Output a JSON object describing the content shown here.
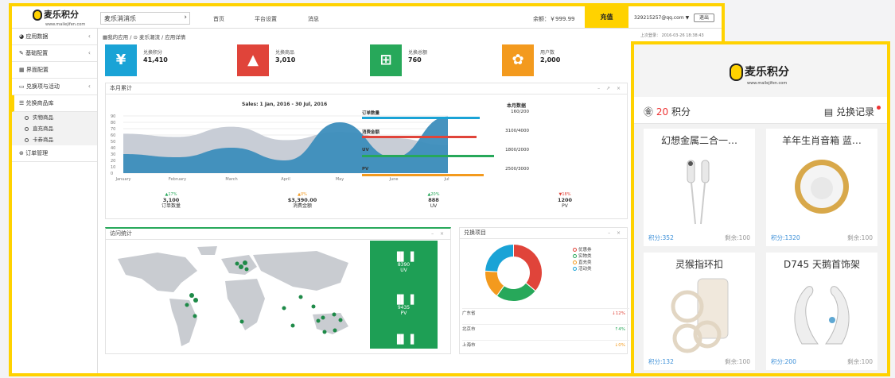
{
  "admin": {
    "logo": {
      "name": "麦乐积分",
      "url": "www.mailejifen.com"
    },
    "app_select": "麦乐消消乐",
    "top_nav": [
      "首页",
      "平台设置",
      "消息"
    ],
    "balance": "余额：￥999.99",
    "recharge": "充值",
    "user": "329215257@qq.com ▼",
    "logout": "退出",
    "last_login": "上次登录： 2016-03-26 18:38:43",
    "sidebar": [
      {
        "label": "应用数据",
        "chev": "‹"
      },
      {
        "label": "基础配置",
        "chev": "‹"
      },
      {
        "label": "界面配置",
        "chev": ""
      },
      {
        "label": "兑换项与活动",
        "chev": "‹"
      },
      {
        "label": "兑换商品库",
        "chev": ""
      }
    ],
    "sidebar_sub": [
      "实物商品",
      "直充商品",
      "卡券商品"
    ],
    "sidebar_last": "订单管理",
    "breadcrumb": "▦我的应用 / ⊙ 麦乐潮流 / 应用详情",
    "cards": [
      {
        "icon": "¥",
        "label": "兑换积分",
        "value": "41,410",
        "color": "#1aa3d6"
      },
      {
        "icon": "▲",
        "label": "兑换商品",
        "value": "3,010",
        "color": "#e0443a"
      },
      {
        "icon": "⊞",
        "label": "兑换总额",
        "value": "760",
        "color": "#27a85a"
      },
      {
        "icon": "✿",
        "label": "用户数",
        "value": "2,000",
        "color": "#f39a1e"
      }
    ],
    "monthly_panel_title": "本月累计",
    "chart_title": "Sales: 1 Jan, 2016 - 30 Jul, 2016",
    "month_data_title": "本月数据",
    "metrics": [
      {
        "name": "订单数量",
        "value": "160/200",
        "fraction": 0.8,
        "color": "#1aa3d6"
      },
      {
        "name": "消费金额",
        "value": "3100/4000",
        "fraction": 0.78,
        "color": "#e0443a"
      },
      {
        "name": "UV",
        "value": "1800/2000",
        "fraction": 0.9,
        "color": "#27a85a"
      },
      {
        "name": "PV",
        "value": "2500/3000",
        "fraction": 0.83,
        "color": "#f39a1e"
      }
    ],
    "stats": [
      {
        "change": "▲17%",
        "num": "3,100",
        "label": "订单数量",
        "color": "#27a85a"
      },
      {
        "change": "▲0%",
        "num": "$3,390.00",
        "label": "消费金额",
        "color": "#f39a1e"
      },
      {
        "change": "▲20%",
        "num": "888",
        "label": "UV",
        "color": "#27a85a"
      },
      {
        "change": "▼18%",
        "num": "1200",
        "label": "PV",
        "color": "#e0443a"
      }
    ],
    "visit_panel_title": "访问统计",
    "visit_blocks": [
      {
        "value": "8390",
        "label": "UV"
      },
      {
        "value": "9435",
        "label": "PV"
      }
    ],
    "exchange_panel_title": "兑换项目",
    "legend": [
      {
        "label": "优惠券",
        "color": "#e0443a"
      },
      {
        "label": "实物类",
        "color": "#27a85a"
      },
      {
        "label": "直充类",
        "color": "#f39a1e"
      },
      {
        "label": "活动类",
        "color": "#1aa3d6"
      }
    ],
    "provinces": [
      {
        "name": "广东省",
        "change": "↓12%",
        "color": "#e0443a"
      },
      {
        "name": "北京市",
        "change": "↑4%",
        "color": "#27a85a"
      },
      {
        "name": "上海市",
        "change": "↓0%",
        "color": "#f39a1e"
      }
    ]
  },
  "chart_data": [
    {
      "type": "area",
      "title": "Sales: 1 Jan, 2016 - 30 Jul, 2016",
      "categories": [
        "January",
        "February",
        "March",
        "April",
        "May",
        "June",
        "July"
      ],
      "series": [
        {
          "values": [
            62,
            57,
            73,
            52,
            65,
            55,
            44
          ],
          "color": "#c8cdd6"
        },
        {
          "values": [
            30,
            25,
            40,
            20,
            80,
            25,
            89
          ],
          "color": "#3c8dbc"
        }
      ],
      "ylim": [
        0,
        90
      ],
      "yticks": [
        0,
        10,
        20,
        30,
        40,
        50,
        60,
        70,
        80,
        90
      ]
    },
    {
      "type": "pie",
      "labels": [
        "优惠券",
        "实物类",
        "直充类",
        "活动类"
      ],
      "values": [
        36,
        24,
        16,
        24
      ],
      "colors": [
        "#e0443a",
        "#27a85a",
        "#f39a1e",
        "#1aa3d6"
      ]
    }
  ],
  "mobile": {
    "logo": {
      "name": "麦乐积分",
      "url": "www.mailejifen.com"
    },
    "points_value": "20",
    "points_unit": "积分",
    "records": "兑换记录",
    "items": [
      {
        "name": "幻想金属二合一…",
        "points": "积分:352",
        "remaining": "剩余:100"
      },
      {
        "name": "羊年生肖音箱 蓝…",
        "points": "积分:1320",
        "remaining": "剩余:100"
      },
      {
        "name": "灵猴指环扣",
        "points": "积分:132",
        "remaining": "剩余:100"
      },
      {
        "name": "D745 天鹅首饰架",
        "points": "积分:200",
        "remaining": "剩余:100"
      }
    ]
  }
}
